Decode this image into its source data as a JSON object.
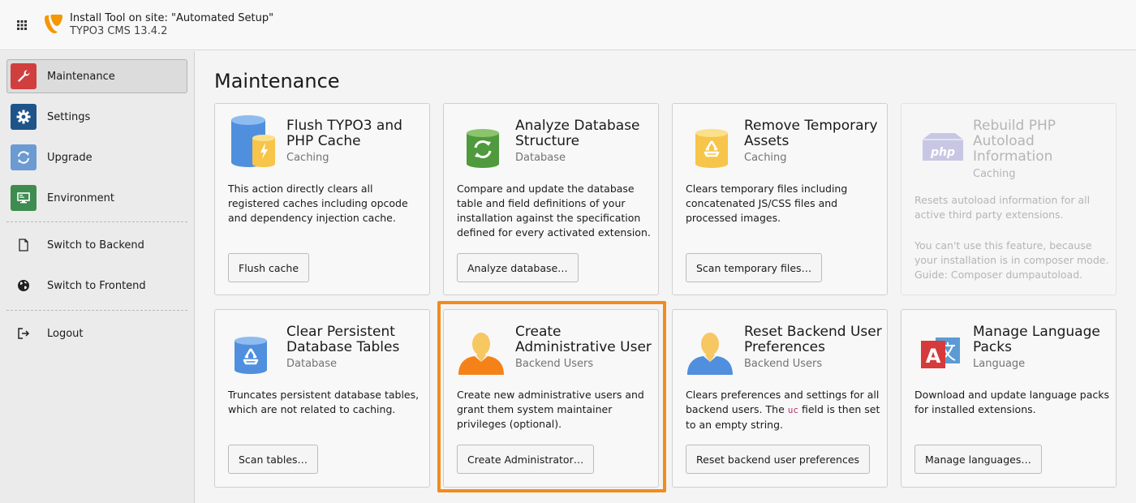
{
  "topbar": {
    "site_title": "Install Tool on site: \"Automated Setup\"",
    "version": "TYPO3 CMS 13.4.2",
    "brand_color": "#f49700"
  },
  "sidebar": {
    "items": [
      {
        "label": "Maintenance",
        "icon": "wrench-icon",
        "color": "#d13e3e",
        "active": true
      },
      {
        "label": "Settings",
        "icon": "gear-icon",
        "color": "#1e5489",
        "active": false
      },
      {
        "label": "Upgrade",
        "icon": "refresh-icon",
        "color": "#6b9bd2",
        "active": false
      },
      {
        "label": "Environment",
        "icon": "monitor-icon",
        "color": "#3e8c4f",
        "active": false
      },
      {
        "label": "Switch to Backend",
        "icon": "file-icon"
      },
      {
        "label": "Switch to Frontend",
        "icon": "globe-icon"
      },
      {
        "label": "Logout",
        "icon": "logout-icon"
      }
    ]
  },
  "main": {
    "title": "Maintenance",
    "highlight_color": "#f18c1d",
    "cards": [
      {
        "title": "Flush TYPO3 and PHP Cache",
        "subtitle": "Caching",
        "description": "This action directly clears all registered caches including opcode and dependency injection cache.",
        "button": "Flush cache",
        "icon": "cache-cylinders-icon"
      },
      {
        "title": "Analyze Database Structure",
        "subtitle": "Database",
        "description": "Compare and update the database table and field definitions of your installation against the specification defined for every activated extension.",
        "button": "Analyze database…",
        "icon": "database-sync-icon"
      },
      {
        "title": "Remove Temporary Assets",
        "subtitle": "Caching",
        "description": "Clears temporary files including concatenated JS/CSS files and processed images.",
        "button": "Scan temporary files…",
        "icon": "recycle-cylinder-icon"
      },
      {
        "title": "Rebuild PHP Autoload Information",
        "subtitle": "Caching",
        "description": "Resets autoload information for all active third party extensions.",
        "note": "You can't use this feature, because your installation is in composer mode. Guide: Composer dumpautoload.",
        "icon": "php-package-icon",
        "disabled": true
      },
      {
        "title": "Clear Persistent Database Tables",
        "subtitle": "Database",
        "description": "Truncates persistent database tables, which are not related to caching.",
        "button": "Scan tables…",
        "icon": "recycle-database-icon"
      },
      {
        "title": "Create Administrative User",
        "subtitle": "Backend Users",
        "description": "Create new administrative users and grant them system maintainer privileges (optional).",
        "button": "Create Administrator…",
        "icon": "admin-user-icon",
        "highlighted": true
      },
      {
        "title": "Reset Backend User Preferences",
        "subtitle": "Backend Users",
        "description_part1": "Clears preferences and settings for all backend users. The",
        "description_code": "uc",
        "description_part2": "field is then set to an empty string.",
        "button": "Reset backend user preferences",
        "icon": "user-icon"
      },
      {
        "title": "Manage Language Packs",
        "subtitle": "Language",
        "description": "Download and update language packs for installed extensions.",
        "button": "Manage languages…",
        "icon": "language-icon"
      }
    ]
  }
}
